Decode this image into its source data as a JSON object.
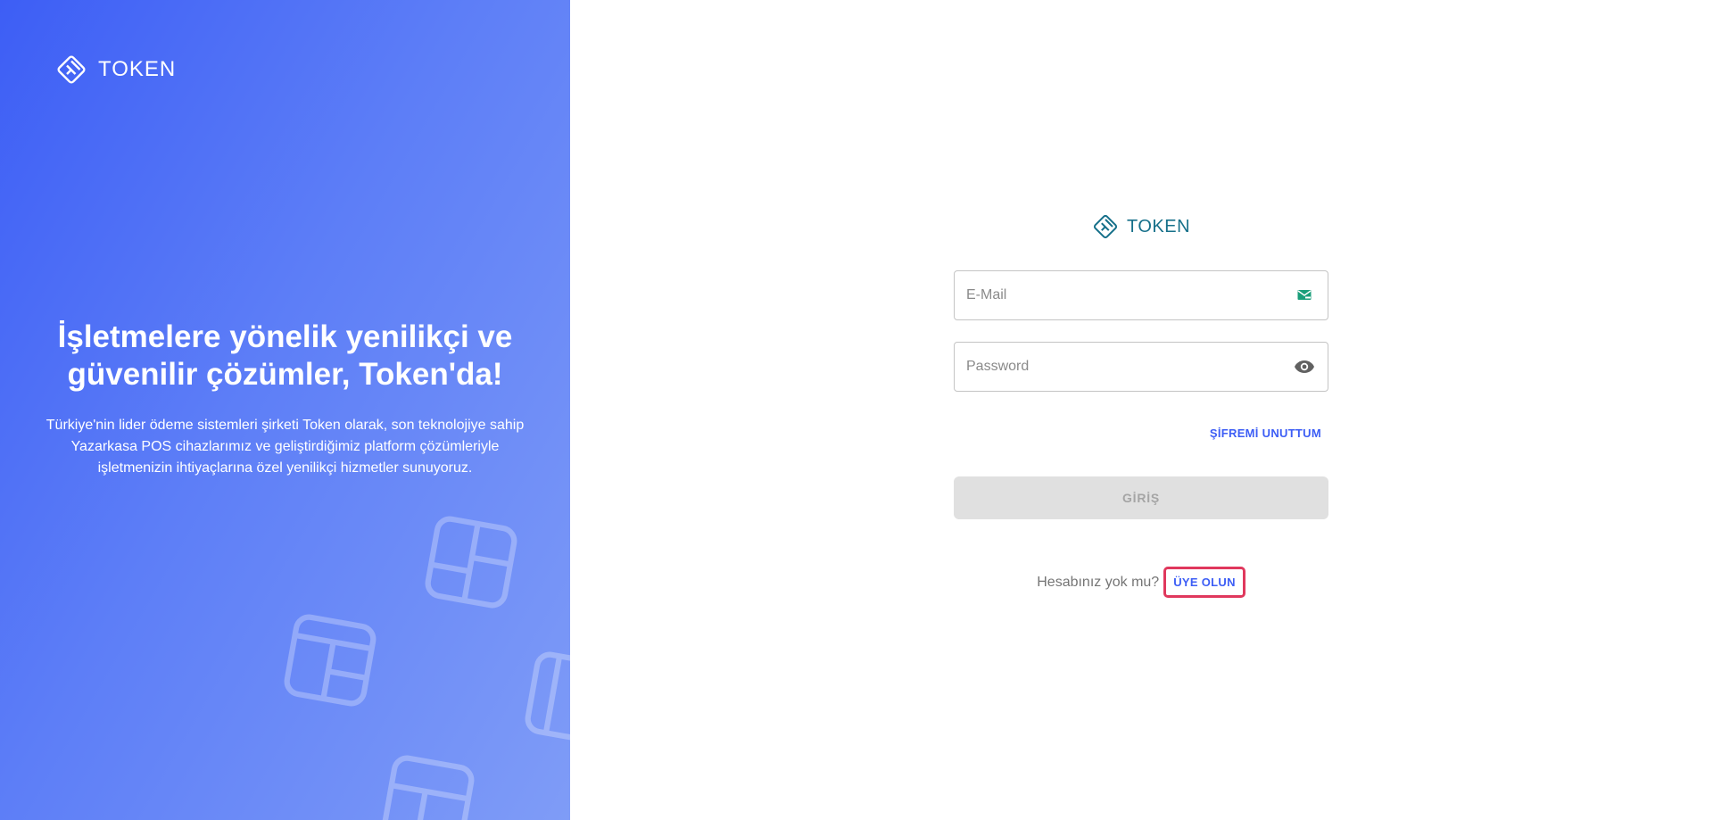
{
  "brand": {
    "name": "TOKEN"
  },
  "hero": {
    "title": "İşletmelere yönelik yenilikçi ve güvenilir çözümler, Token'da!",
    "description": "Türkiye'nin lider ödeme sistemleri şirketi Token olarak, son teknolojiye sahip Yazarkasa POS cihazlarımız ve geliştirdiğimiz platform çözümleriyle işletmenizin ihtiyaçlarına özel yenilikçi hizmetler sunuyoruz."
  },
  "login": {
    "email": {
      "value": "",
      "placeholder": "E-Mail",
      "icon": "mail-icon"
    },
    "password": {
      "value": "",
      "placeholder": "Password",
      "icon": "eye-icon"
    },
    "forgot_label": "ŞİFREMİ UNUTTUM",
    "submit_label": "GİRİŞ",
    "signup_question": "Hesabınız yok mu?",
    "signup_label": "ÜYE OLUN"
  },
  "colors": {
    "primary": "#3d5ef5",
    "brand_teal": "#16708a",
    "highlight": "#e0385d",
    "email_icon": "#1a9e7a"
  }
}
